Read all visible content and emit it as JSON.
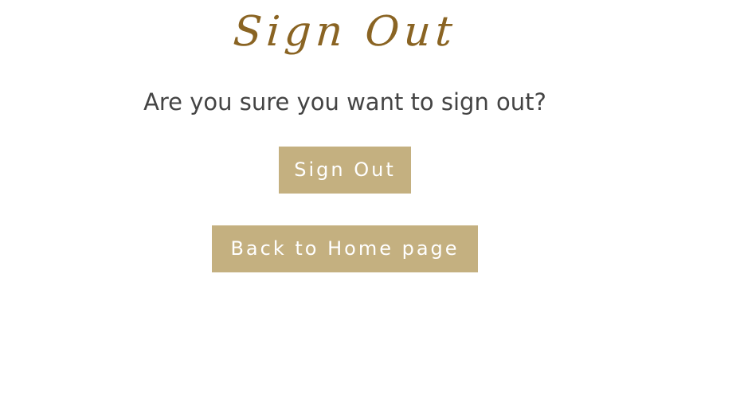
{
  "page": {
    "title": "Sign Out",
    "question": "Are you sure you want to sign out?"
  },
  "actions": {
    "sign_out_label": "Sign Out",
    "back_home_label": "Back to Home page"
  },
  "colors": {
    "title": "#8a6423",
    "button_bg": "#c4b080",
    "button_text": "#ffffff",
    "question_text": "#444444"
  }
}
